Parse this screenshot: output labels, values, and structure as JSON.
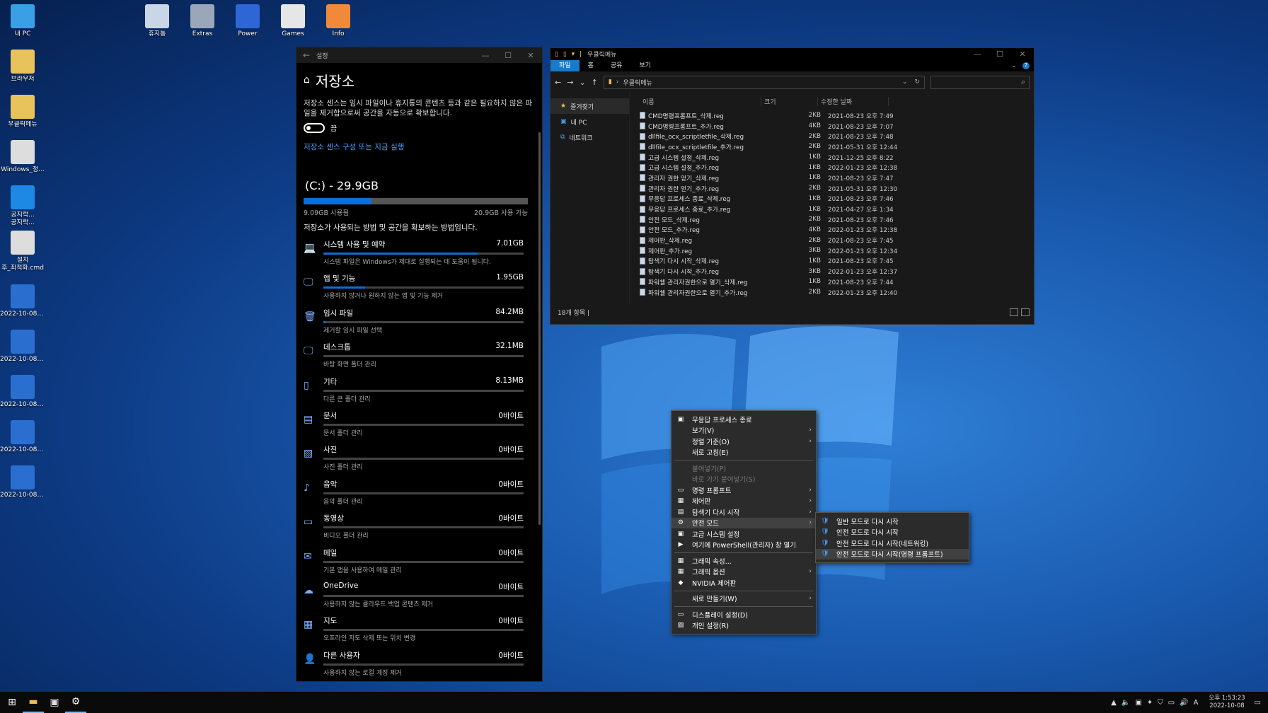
{
  "desktop": {
    "icons": [
      {
        "label": "내 PC",
        "color": "#3aa0e6"
      },
      {
        "label": "브라우저",
        "color": "#e8c25a"
      },
      {
        "label": "우클릭메뉴",
        "color": "#e8c25a"
      },
      {
        "label": "Windows_정...",
        "color": "#dddddd"
      },
      {
        "label": "공지락...\n공지락...",
        "color": "#1e88e5"
      },
      {
        "label": "설치\n후_최적화.cmd",
        "color": "#dddddd"
      },
      {
        "label": "2022-10-08_13....",
        "color": "#2a6fd0"
      },
      {
        "label": "2022-10-08_13....",
        "color": "#2a6fd0"
      },
      {
        "label": "2022-10-08_13....",
        "color": "#2a6fd0"
      },
      {
        "label": "2022-10-08_13....",
        "color": "#2a6fd0"
      },
      {
        "label": "2022-10-08_13....",
        "color": "#2a6fd0"
      }
    ],
    "top_icons": [
      {
        "label": "휴지통",
        "color": "#c9d6e8"
      },
      {
        "label": "Extras",
        "color": "#9aa7b8"
      },
      {
        "label": "Power",
        "color": "#2f66d6"
      },
      {
        "label": "Games",
        "color": "#e6e6e6"
      },
      {
        "label": "Info",
        "color": "#f08a3a"
      }
    ]
  },
  "settings": {
    "window_title": "설정",
    "back": "←",
    "min": "—",
    "max": "☐",
    "close": "✕",
    "home_icon": "⌂",
    "heading": "저장소",
    "description": "저장소 센스는 임시 파일이나 휴지통의 콘텐츠 등과 같은 필요하지 않은 파일을 제거함으로써 공간을 자동으로 확보합니다.",
    "toggle_label": "끔",
    "link": "저장소 센스 구성 또는 지금 실행",
    "drive_title": "(C:) - 29.9GB",
    "drive_used": "9.09GB 사용됨",
    "drive_free": "20.9GB 사용 가능",
    "drive_used_fraction": 0.304,
    "subheading": "저장소가 사용되는 방법 및 공간을 확보하는 방법입니다.",
    "categories": [
      {
        "icon": "💻",
        "name": "시스템 사용 및 예약",
        "size": "7.01GB",
        "desc": "시스템 파일은 Windows가 제대로 실행되는 데 도움이 됩니다.",
        "fraction": 0.77
      },
      {
        "icon": "🖵",
        "name": "앱 및 기능",
        "size": "1.95GB",
        "desc": "사용하지 않거나 원하지 않는 앱 및 기능 제거",
        "fraction": 0.21
      },
      {
        "icon": "🗑",
        "name": "임시 파일",
        "size": "84.2MB",
        "desc": "제거할 임시 파일 선택",
        "fraction": 0.01
      },
      {
        "icon": "🖵",
        "name": "데스크톱",
        "size": "32.1MB",
        "desc": "바탕 화면 폴더 관리",
        "fraction": 0.0
      },
      {
        "icon": "▯",
        "name": "기타",
        "size": "8.13MB",
        "desc": "다른 큰 폴더 관리",
        "fraction": 0.0
      },
      {
        "icon": "▤",
        "name": "문서",
        "size": "0바이트",
        "desc": "문서 폴더 관리",
        "fraction": 0.0
      },
      {
        "icon": "▨",
        "name": "사진",
        "size": "0바이트",
        "desc": "사진 폴더 관리",
        "fraction": 0.0
      },
      {
        "icon": "♪",
        "name": "음악",
        "size": "0바이트",
        "desc": "음악 폴더 관리",
        "fraction": 0.0
      },
      {
        "icon": "▭",
        "name": "동영상",
        "size": "0바이트",
        "desc": "비디오 폴더 관리",
        "fraction": 0.0
      },
      {
        "icon": "✉",
        "name": "메일",
        "size": "0바이트",
        "desc": "기본 앱을 사용하여 메일 관리",
        "fraction": 0.0
      },
      {
        "icon": "☁",
        "name": "OneDrive",
        "size": "0바이트",
        "desc": "사용하지 않는 클라우드 백업 콘텐츠 제거",
        "fraction": 0.0
      },
      {
        "icon": "▦",
        "name": "지도",
        "size": "0바이트",
        "desc": "오프라인 지도 삭제 또는 위치 변경",
        "fraction": 0.0
      },
      {
        "icon": "👤",
        "name": "다른 사용자",
        "size": "0바이트",
        "desc": "사용하지 않는 로컬 계정 제거",
        "fraction": 0.0
      }
    ]
  },
  "explorer": {
    "title": "우클릭메뉴",
    "quick": "▯ ▯ ▾ |",
    "min": "—",
    "max": "☐",
    "close": "✕",
    "ribbon_tabs": [
      "파일",
      "홈",
      "공유",
      "보기"
    ],
    "ribbon_expand": "⌄",
    "help": "?",
    "address": "우클릭메뉴",
    "path_sep": "›",
    "nav_back": "←",
    "nav_fwd": "→",
    "nav_down": "⌄",
    "nav_up": "↑",
    "addr_drop": "⌄",
    "refresh": "↻",
    "search_icon": "⌕",
    "nav_items": [
      {
        "label": "즐겨찾기",
        "icon": "★",
        "color": "#f2c94c"
      },
      {
        "label": "내 PC",
        "icon": "▣",
        "color": "#3aa0e6"
      },
      {
        "label": "네트워크",
        "icon": "⧉",
        "color": "#3aa0e6"
      }
    ],
    "columns": [
      "이름",
      "크기",
      "수정한 날짜"
    ],
    "files": [
      {
        "name": "CMD명령프롬프트_삭제.reg",
        "size": "2KB",
        "date": "2021-08-23 오후 7:49"
      },
      {
        "name": "CMD명령프롬프트_추가.reg",
        "size": "4KB",
        "date": "2021-08-23 오후 7:07"
      },
      {
        "name": "dllfile_ocx_scriptletfile_삭제.reg",
        "size": "2KB",
        "date": "2021-08-23 오후 7:48"
      },
      {
        "name": "dllfile_ocx_scriptletfile_추가.reg",
        "size": "2KB",
        "date": "2021-05-31 오후 12:44"
      },
      {
        "name": "고급 시스템 설정_삭제.reg",
        "size": "1KB",
        "date": "2021-12-25 오후 8:22"
      },
      {
        "name": "고급 시스템 설정_추가.reg",
        "size": "1KB",
        "date": "2022-01-23 오후 12:38"
      },
      {
        "name": "관리자 권한 얻기_삭제.reg",
        "size": "1KB",
        "date": "2021-08-23 오후 7:47"
      },
      {
        "name": "관리자 권한 얻기_추가.reg",
        "size": "2KB",
        "date": "2021-05-31 오후 12:30"
      },
      {
        "name": "무응답 프로세스 종료_삭제.reg",
        "size": "1KB",
        "date": "2021-08-23 오후 7:46"
      },
      {
        "name": "무응답 프로세스 종료_추가.reg",
        "size": "1KB",
        "date": "2021-04-27 오후 1:34"
      },
      {
        "name": "안전 모드_삭제.reg",
        "size": "2KB",
        "date": "2021-08-23 오후 7:46"
      },
      {
        "name": "안전 모드_추가.reg",
        "size": "4KB",
        "date": "2022-01-23 오후 12:38"
      },
      {
        "name": "제어판_삭제.reg",
        "size": "2KB",
        "date": "2021-08-23 오후 7:45"
      },
      {
        "name": "제어판_추가.reg",
        "size": "3KB",
        "date": "2022-01-23 오후 12:34"
      },
      {
        "name": "탐색기 다시 시작_삭제.reg",
        "size": "1KB",
        "date": "2021-08-23 오후 7:45"
      },
      {
        "name": "탐색기 다시 시작_추가.reg",
        "size": "3KB",
        "date": "2022-01-23 오후 12:37"
      },
      {
        "name": "파워쉘 관리자권한으로 열기_삭제.reg",
        "size": "1KB",
        "date": "2021-08-23 오후 7:44"
      },
      {
        "name": "파워쉘 관리자권한으로 열기_추가.reg",
        "size": "2KB",
        "date": "2022-01-23 오후 12:40"
      }
    ],
    "status": "18개 항목 |"
  },
  "context_menu": [
    {
      "label": "무응답 프로세스 종료",
      "icon": "▣"
    },
    {
      "label": "보기(V)",
      "arrow": true
    },
    {
      "label": "정렬 기준(O)",
      "arrow": true
    },
    {
      "label": "새로 고침(E)"
    },
    {
      "sep": true
    },
    {
      "label": "붙여넣기(P)",
      "disabled": true
    },
    {
      "label": "바로 가기 붙여넣기(S)",
      "disabled": true
    },
    {
      "label": "명령 프롬프트",
      "icon": "▭",
      "arrow": true
    },
    {
      "label": "제어판",
      "icon": "▦",
      "arrow": true
    },
    {
      "label": "탐색기 다시 시작",
      "icon": "▤",
      "arrow": true
    },
    {
      "label": "안전 모드",
      "icon": "⚙",
      "arrow": true,
      "highlight": true
    },
    {
      "label": "고급 시스템 설정",
      "icon": "▣"
    },
    {
      "label": "여기에 PowerShell(관리자) 창 열기",
      "icon": "▶"
    },
    {
      "sep": true
    },
    {
      "label": "그래픽 속성...",
      "icon": "▦"
    },
    {
      "label": "그래픽 옵션",
      "icon": "▦",
      "arrow": true
    },
    {
      "label": "NVIDIA 제어판",
      "icon": "◆"
    },
    {
      "sep": true
    },
    {
      "label": "새로 만들기(W)",
      "arrow": true
    },
    {
      "sep": true
    },
    {
      "label": "디스플레이 설정(D)",
      "icon": "▭"
    },
    {
      "label": "개인 설정(R)",
      "icon": "▨"
    }
  ],
  "submenu": [
    {
      "label": "일반 모드로 다시 시작"
    },
    {
      "label": "안전 모드로 다시 시작"
    },
    {
      "label": "안전 모드로 다시 시작(네트워킹)"
    },
    {
      "label": "안전 모드로 다시 시작(명령 프롬프트)",
      "highlight": true
    }
  ],
  "submenu_icon": "🛡",
  "arrow_glyph": "›",
  "taskbar": {
    "start": "⊞",
    "explorer": "▬",
    "store": "▣",
    "settings": "⚙",
    "tray": [
      "▲",
      "🔈",
      "▣",
      "✦",
      "⛉",
      "▭",
      "🔊"
    ],
    "ime": "A",
    "time": "오후 1:53:23",
    "date": "2022-10-08",
    "notify": "▭"
  }
}
